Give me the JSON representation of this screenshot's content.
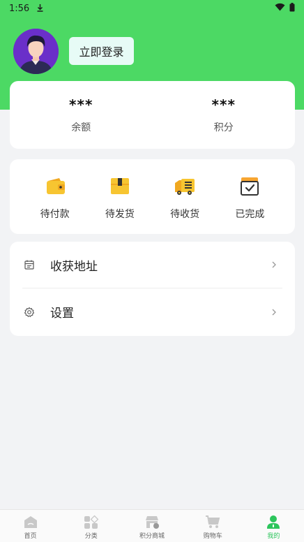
{
  "status_bar": {
    "time": "1:56"
  },
  "header": {
    "login_label": "立即登录"
  },
  "stats": [
    {
      "value": "***",
      "label": "余额"
    },
    {
      "value": "***",
      "label": "积分"
    }
  ],
  "orders": [
    {
      "label": "待付款",
      "icon": "wallet-icon"
    },
    {
      "label": "待发货",
      "icon": "box-icon"
    },
    {
      "label": "待收货",
      "icon": "truck-icon"
    },
    {
      "label": "已完成",
      "icon": "completed-box-icon"
    }
  ],
  "menu": [
    {
      "label": "收获地址",
      "icon": "calendar-icon"
    },
    {
      "label": "设置",
      "icon": "gear-icon"
    }
  ],
  "tabbar": [
    {
      "label": "首页",
      "icon": "home-icon"
    },
    {
      "label": "分类",
      "icon": "category-icon"
    },
    {
      "label": "积分商城",
      "icon": "store-icon"
    },
    {
      "label": "购物车",
      "icon": "cart-icon"
    },
    {
      "label": "我的",
      "icon": "profile-icon",
      "active": true
    }
  ],
  "colors": {
    "brand_green": "#4cd964",
    "active_tab": "#2cc55c",
    "icon_yellow": "#f7c531"
  }
}
